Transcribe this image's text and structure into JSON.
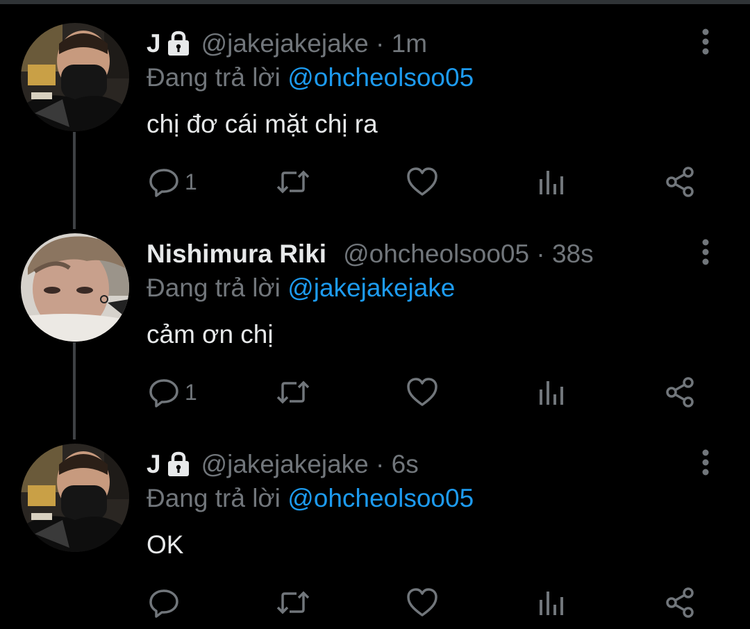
{
  "reply_prefix": "Đang trả lời",
  "icons": {
    "lock": "lock-icon",
    "more": "more-vertical-icon",
    "reply": "comment-icon",
    "retweet": "retweet-icon",
    "like": "heart-icon",
    "analytics": "analytics-icon",
    "share": "share-icon"
  },
  "colors": {
    "background": "#000000",
    "text": "#e7e9ea",
    "muted": "#71767b",
    "accent": "#1d9bf0"
  },
  "tweets": [
    {
      "name": "J",
      "protected": true,
      "handle": "@jakejakejake · 1m",
      "reply_to": "@ohcheolsoo05",
      "text": "chị đơ cái mặt chị ra",
      "reply_count": "1"
    },
    {
      "name": "Nishimura Riki",
      "protected": false,
      "handle": "@ohcheolsoo05 · 38s",
      "reply_to": "@jakejakejake",
      "text": "cảm ơn chị",
      "reply_count": "1"
    },
    {
      "name": "J",
      "protected": true,
      "handle": "@jakejakejake · 6s",
      "reply_to": "@ohcheolsoo05",
      "text": "OK",
      "reply_count": ""
    }
  ]
}
